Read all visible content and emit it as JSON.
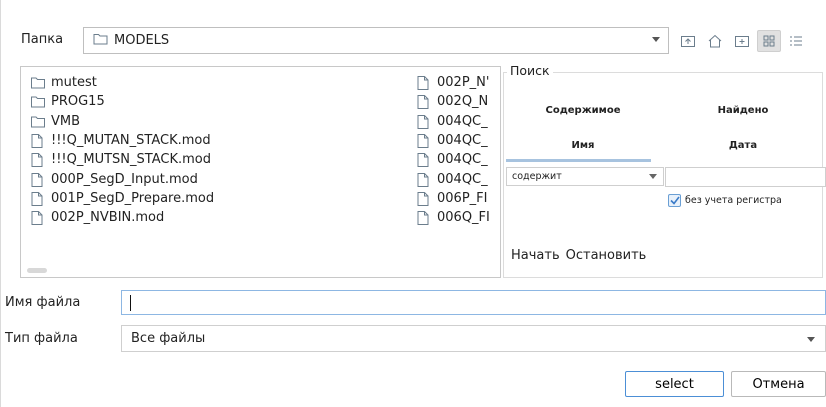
{
  "folder": {
    "label": "Папка",
    "path": "MODELS"
  },
  "toolbar": {
    "icons": [
      "folder-up-icon",
      "home-icon",
      "new-folder-icon",
      "grid-view-icon",
      "list-view-icon"
    ]
  },
  "files": {
    "column1": [
      {
        "name": "mutest",
        "type": "folder"
      },
      {
        "name": "PROG15",
        "type": "folder"
      },
      {
        "name": "VMB",
        "type": "folder"
      },
      {
        "name": "!!!Q_MUTAN_STACK.mod",
        "type": "file"
      },
      {
        "name": "!!!Q_MUTSN_STACK.mod",
        "type": "file"
      },
      {
        "name": "000P_SegD_Input.mod",
        "type": "file"
      },
      {
        "name": "001P_SegD_Prepare.mod",
        "type": "file"
      },
      {
        "name": "002P_NVBIN.mod",
        "type": "file"
      }
    ],
    "column2": [
      {
        "name": "002P_N'",
        "type": "file"
      },
      {
        "name": "002Q_N",
        "type": "file"
      },
      {
        "name": "004QC_",
        "type": "file"
      },
      {
        "name": "004QC_",
        "type": "file"
      },
      {
        "name": "004QC_",
        "type": "file"
      },
      {
        "name": "004QC_",
        "type": "file"
      },
      {
        "name": "006P_FI",
        "type": "file"
      },
      {
        "name": "006Q_FI",
        "type": "file"
      }
    ]
  },
  "search": {
    "title": "Поиск",
    "col_content": "Содержимое",
    "col_found": "Найдено",
    "col_name": "Имя",
    "col_date": "Дата",
    "condition": "содержит",
    "case_insensitive": "без учета регистра",
    "case_checked": true,
    "start": "Начать",
    "stop": "Остановить"
  },
  "filename": {
    "label": "Имя файла",
    "value": ""
  },
  "filetype": {
    "label": "Тип файла",
    "value": "Все файлы"
  },
  "buttons": {
    "select": "select",
    "cancel": "Отмена"
  },
  "colors": {
    "accent": "#4c8fd6",
    "border": "#c8c8c8",
    "icon": "#6b7d8c",
    "tab_underline": "#a7c3df"
  }
}
